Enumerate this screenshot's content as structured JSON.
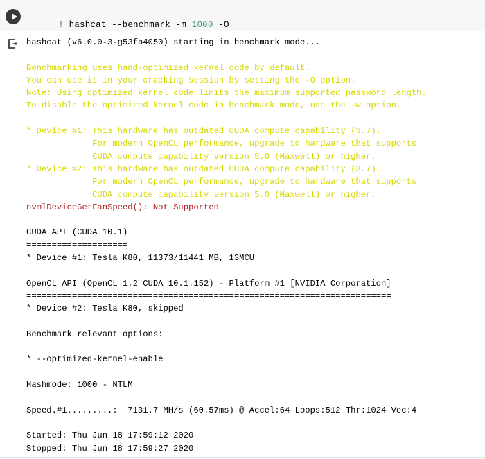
{
  "cell": {
    "run_button_label": "Run cell",
    "output_icon_name": "output-arrow-icon",
    "code_prefix": "!",
    "code_rest": " hashcat --benchmark -m ",
    "code_number": "1000",
    "code_tail": " -O",
    "full_command": "! hashcat --benchmark -m 1000 -O"
  },
  "output": {
    "lines": [
      {
        "text": "hashcat (v6.0.0-3-g53fb4050) starting in benchmark mode...",
        "color": "black"
      },
      {
        "text": "",
        "color": "black"
      },
      {
        "text": "Benchmarking uses hand-optimized kernel code by default.",
        "color": "yellow"
      },
      {
        "text": "You can use it in your cracking session by setting the -O option.",
        "color": "yellow"
      },
      {
        "text": "Note: Using optimized kernel code limits the maximum supported password length.",
        "color": "yellow"
      },
      {
        "text": "To disable the optimized kernel code in benchmark mode, use the -w option.",
        "color": "yellow"
      },
      {
        "text": "",
        "color": "black"
      },
      {
        "text": "* Device #1: This hardware has outdated CUDA compute capability (3.7).",
        "color": "yellow"
      },
      {
        "text": "             For modern OpenCL performance, upgrade to hardware that supports",
        "color": "yellow"
      },
      {
        "text": "             CUDA compute capability version 5.0 (Maxwell) or higher.",
        "color": "yellow"
      },
      {
        "text": "* Device #2: This hardware has outdated CUDA compute capability (3.7).",
        "color": "yellow"
      },
      {
        "text": "             For modern OpenCL performance, upgrade to hardware that supports",
        "color": "yellow"
      },
      {
        "text": "             CUDA compute capability version 5.0 (Maxwell) or higher.",
        "color": "yellow"
      },
      {
        "text": "nvmlDeviceGetFanSpeed(): Not Supported",
        "color": "red"
      },
      {
        "text": "",
        "color": "black"
      },
      {
        "text": "CUDA API (CUDA 10.1)",
        "color": "black"
      },
      {
        "text": "====================",
        "color": "black"
      },
      {
        "text": "* Device #1: Tesla K80, 11373/11441 MB, 13MCU",
        "color": "black"
      },
      {
        "text": "",
        "color": "black"
      },
      {
        "text": "OpenCL API (OpenCL 1.2 CUDA 10.1.152) - Platform #1 [NVIDIA Corporation]",
        "color": "black"
      },
      {
        "text": "========================================================================",
        "color": "black"
      },
      {
        "text": "* Device #2: Tesla K80, skipped",
        "color": "black"
      },
      {
        "text": "",
        "color": "black"
      },
      {
        "text": "Benchmark relevant options:",
        "color": "black"
      },
      {
        "text": "===========================",
        "color": "black"
      },
      {
        "text": "* --optimized-kernel-enable",
        "color": "black"
      },
      {
        "text": "",
        "color": "black"
      },
      {
        "text": "Hashmode: 1000 - NTLM",
        "color": "black"
      },
      {
        "text": "",
        "color": "black"
      },
      {
        "text": "Speed.#1.........:  7131.7 MH/s (60.57ms) @ Accel:64 Loops:512 Thr:1024 Vec:4",
        "color": "black"
      },
      {
        "text": "",
        "color": "black"
      },
      {
        "text": "Started: Thu Jun 18 17:59:12 2020",
        "color": "black"
      },
      {
        "text": "Stopped: Thu Jun 18 17:59:27 2020",
        "color": "black"
      }
    ]
  },
  "colors": {
    "cell_background": "#f7f7f7",
    "warning_yellow": "#d7d700",
    "error_red": "#b02020",
    "number_token": "#3b9c6e",
    "bang_token": "#4070a0",
    "run_button": "#393939"
  }
}
